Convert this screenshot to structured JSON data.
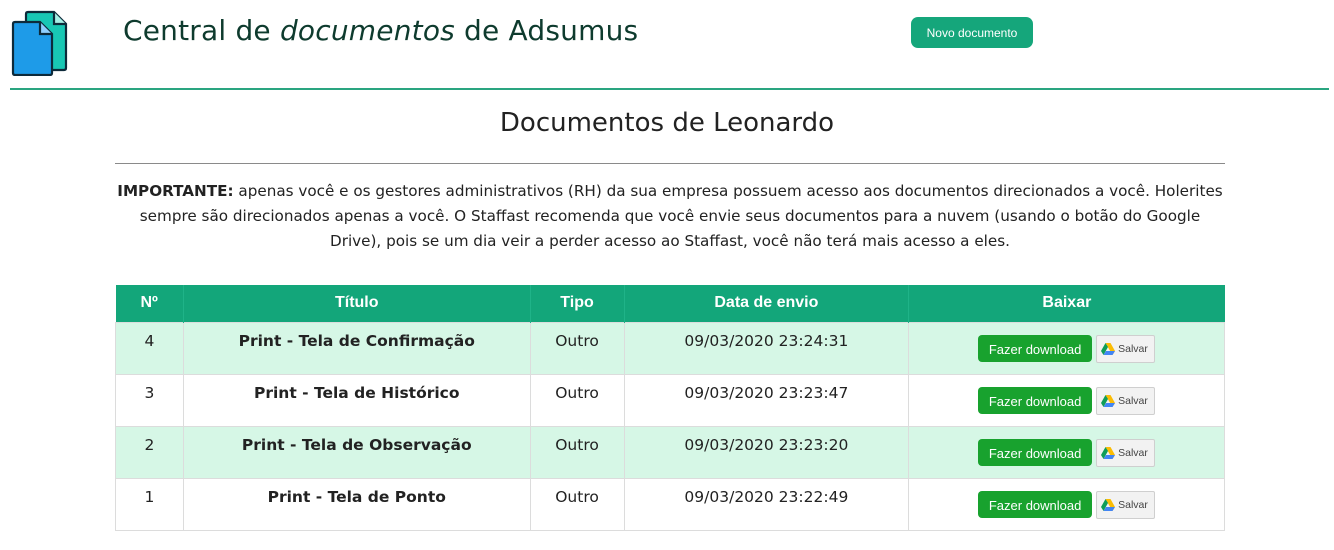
{
  "header": {
    "title_part1": "Central de ",
    "title_emphasis": "documentos",
    "title_part2": " de Adsumus",
    "new_document_label": "Novo documento"
  },
  "page_title": "Documentos de Leonardo",
  "notice": {
    "label": "IMPORTANTE:",
    "text": " apenas você e os gestores administrativos (RH) da sua empresa possuem acesso aos documentos direcionados a você. Holerites sempre são direcionados apenas a você. O Staffast recomenda que você envie seus documentos para a nuvem (usando o botão do Google Drive), pois se um dia veir a perder acesso ao Staffast, você não terá mais acesso a eles."
  },
  "table": {
    "headers": [
      "Nº",
      "Título",
      "Tipo",
      "Data de envio",
      "Baixar"
    ],
    "download_label": "Fazer download",
    "save_label": "Salvar",
    "rows": [
      {
        "num": "4",
        "title": "Print - Tela de Confirmação",
        "type": "Outro",
        "date": "09/03/2020 23:24:31"
      },
      {
        "num": "3",
        "title": "Print - Tela de Histórico",
        "type": "Outro",
        "date": "09/03/2020 23:23:47"
      },
      {
        "num": "2",
        "title": "Print - Tela de Observação",
        "type": "Outro",
        "date": "09/03/2020 23:23:20"
      },
      {
        "num": "1",
        "title": "Print - Tela de Ponto",
        "type": "Outro",
        "date": "09/03/2020 23:22:49"
      }
    ]
  },
  "colors": {
    "brand_green": "#13a67a",
    "download_green": "#18a22e",
    "row_highlight": "#d6f7e6",
    "title_color": "#0e3b2e"
  },
  "icons": {
    "logo": "documents-icon",
    "drive": "google-drive-icon"
  }
}
